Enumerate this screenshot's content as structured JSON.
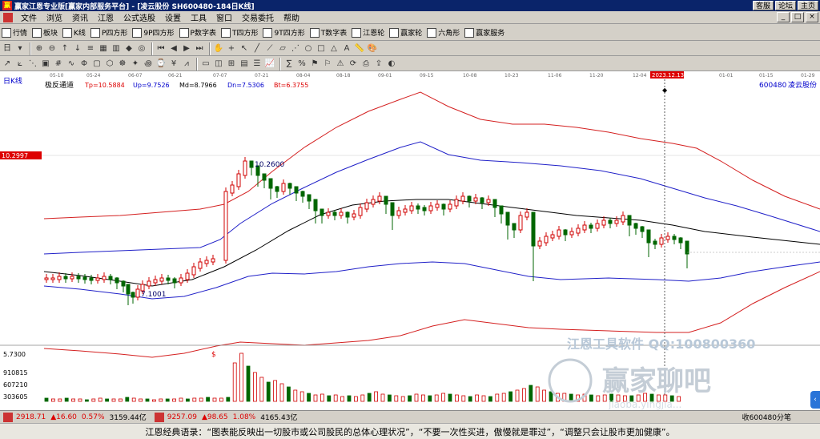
{
  "window": {
    "title": "赢家江恩专业版[赢家内部服务平台] - [凌云股份   SH600480-184日K线]",
    "buttons": [
      "客服",
      "论坛",
      "主页"
    ]
  },
  "menu": {
    "items": [
      "文件",
      "浏览",
      "资讯",
      "江恩",
      "公式选股",
      "设置",
      "工具",
      "窗口",
      "交易委托",
      "帮助"
    ],
    "window_controls": [
      "_",
      "□",
      "×"
    ]
  },
  "toolbar1": {
    "items": [
      {
        "label": "行情",
        "icon": "quote-icon"
      },
      {
        "label": "板块",
        "icon": "sector-icon"
      },
      {
        "label": "K线",
        "icon": "kline-icon"
      },
      {
        "label": "P四方形",
        "icon": "p-square-icon"
      },
      {
        "label": "9P四方形",
        "icon": "9p-square-icon"
      },
      {
        "label": "P数字表",
        "icon": "p-number-table-icon"
      },
      {
        "label": "T四方形",
        "icon": "t-square-icon"
      },
      {
        "label": "9T四方形",
        "icon": "9t-square-icon"
      },
      {
        "label": "T数字表",
        "icon": "t-number-table-icon"
      },
      {
        "label": "江恩轮",
        "icon": "gann-wheel-icon"
      },
      {
        "label": "赢家轮",
        "icon": "winner-wheel-icon"
      },
      {
        "label": "六角形",
        "icon": "hexagon-icon"
      },
      {
        "label": "赢家服务",
        "icon": "service-icon"
      }
    ]
  },
  "chart": {
    "period_label": "日K线",
    "indicator_name": "极反通道",
    "tp": "Tp=10.5884",
    "up": "Up=9.7526",
    "md": "Md=8.7966",
    "dn": "Dn=7.5306",
    "bt": "Bt=6.3755",
    "symbol": "600480",
    "stock_name": "凌云股份",
    "cursor_date": "2023.12.13",
    "price_label": "10.2997",
    "high_label": "10.2600",
    "low_label": "7.1001",
    "date_ticks": [
      "05-10",
      "05-24",
      "06-07",
      "06-21",
      "07-07",
      "07-21",
      "08-04",
      "08-18",
      "09-01",
      "09-15",
      "10-08",
      "10-23",
      "11-06",
      "11-20",
      "12-04",
      "01-01",
      "01-15",
      "01-29"
    ],
    "vol_max": "5.7300",
    "vol_ticks": [
      "910815",
      "607210",
      "303605"
    ],
    "watermark_line1": "江恩工具软件  QQ:100800360",
    "watermark_line2": "赢家聊吧",
    "watermark_url": "jiaoba.yingjia...",
    "accent_colors": {
      "upper_band": "#d42020",
      "mid_band": "#2020c8",
      "median": "#000000",
      "up_candle": "#d00000",
      "down_candle": "#006600"
    }
  },
  "statusbar": {
    "idx1_value": "2918.71",
    "idx1_change": "▲16.60",
    "idx1_pct": "0.57%",
    "idx1_amount": "3159.44亿",
    "idx2_value": "9257.09",
    "idx2_change": "▲98.65",
    "idx2_pct": "1.08%",
    "idx2_amount": "4165.43亿",
    "right_text": "收600480分笔"
  },
  "tip": "江恩经典语录：“图表能反映出一切股市或公司股民的总体心理状况”，“不要一次性买进，傲慢就是罪过”，“调整只会让股市更加健康”。"
}
